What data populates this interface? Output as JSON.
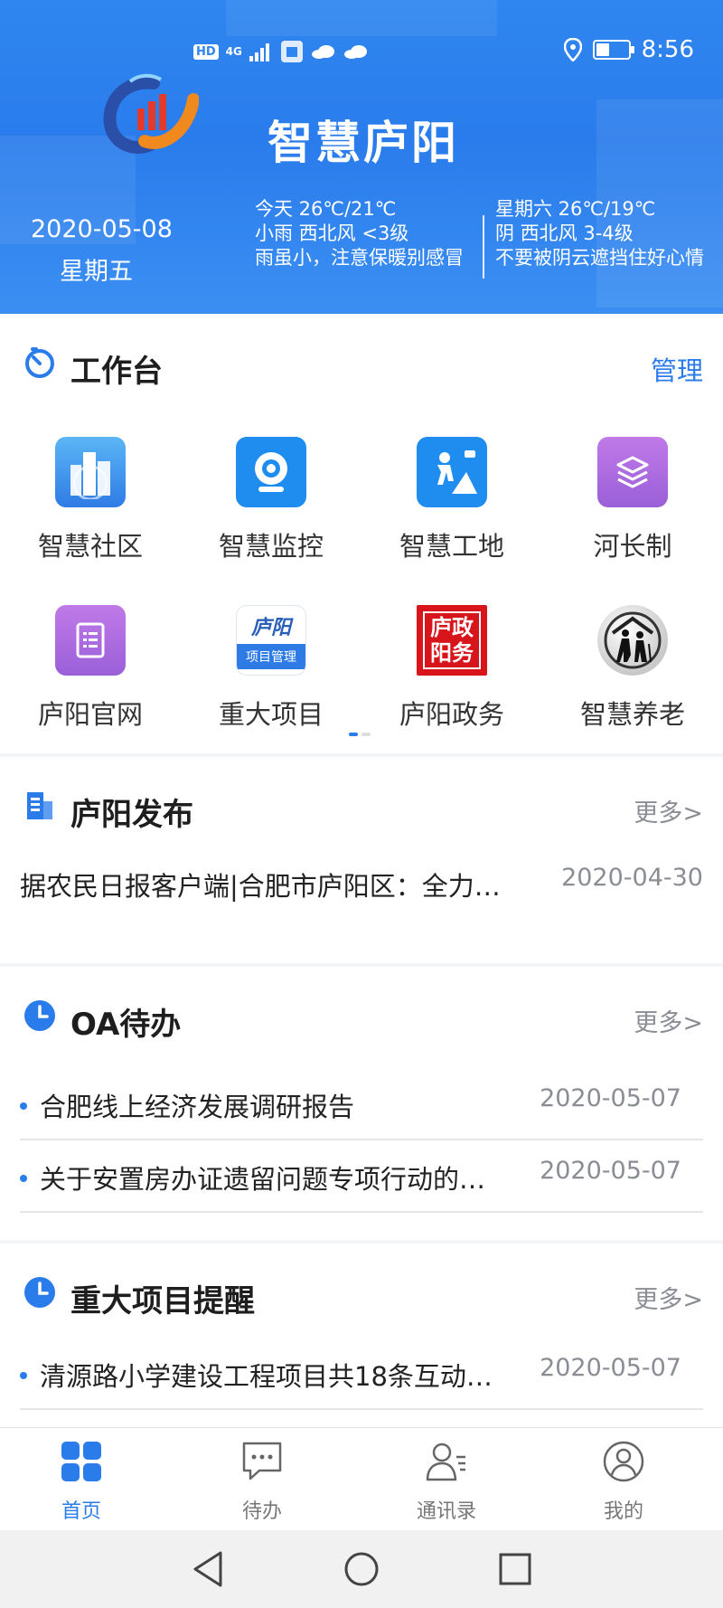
{
  "status_bar": {
    "hd": "HD",
    "network": "4G",
    "time": "8:56"
  },
  "header": {
    "app_title": "智慧庐阳",
    "date": "2020-05-08",
    "weekday": "星期五",
    "today": {
      "line1": "今天  26℃/21℃",
      "line2": "小雨  西北风  <3级",
      "line3": "雨虽小，注意保暖别感冒"
    },
    "tomorrow": {
      "line1": "星期六  26℃/19℃",
      "line2": "阴  西北风  3-4级",
      "line3": "不要被阴云遮挡住好心情"
    }
  },
  "workbench": {
    "title": "工作台",
    "manage_label": "管理",
    "apps": [
      {
        "label": "智慧社区",
        "icon": "city-buildings-icon"
      },
      {
        "label": "智慧监控",
        "icon": "camera-icon"
      },
      {
        "label": "智慧工地",
        "icon": "construction-worker-icon"
      },
      {
        "label": "河长制",
        "icon": "layers-icon"
      },
      {
        "label": "庐阳官网",
        "icon": "document-list-icon"
      },
      {
        "label": "重大项目",
        "icon": "project-management-icon",
        "icon_text_top": "庐阳",
        "icon_text_bottom": "项目管理"
      },
      {
        "label": "庐阳政务",
        "icon": "seal-icon",
        "icon_text": "庐政阳务"
      },
      {
        "label": "智慧养老",
        "icon": "elderly-icon"
      }
    ],
    "page_indicator": {
      "pages": 2,
      "current": 1
    }
  },
  "news": {
    "title": "庐阳发布",
    "more_label": "更多>",
    "items": [
      {
        "title": "据农民日报客户端|合肥市庐阳区：全力…",
        "date": "2020-04-30"
      }
    ]
  },
  "oa": {
    "title": "OA待办",
    "more_label": "更多>",
    "items": [
      {
        "title": "合肥线上经济发展调研报告",
        "date": "2020-05-07"
      },
      {
        "title": "关于安置房办证遗留问题专项行动的…",
        "date": "2020-05-07"
      }
    ]
  },
  "projects": {
    "title": "重大项目提醒",
    "more_label": "更多>",
    "items": [
      {
        "title": "清源路小学建设工程项目共18条互动…",
        "date": "2020-05-07"
      }
    ]
  },
  "tabbar": {
    "items": [
      {
        "label": "首页",
        "icon": "home-grid-icon",
        "active": true
      },
      {
        "label": "待办",
        "icon": "chat-bubble-icon",
        "active": false
      },
      {
        "label": "通讯录",
        "icon": "contacts-icon",
        "active": false
      },
      {
        "label": "我的",
        "icon": "profile-icon",
        "active": false
      }
    ]
  },
  "colors": {
    "accent": "#2b7ceb",
    "header_blue": "#2f86f0",
    "muted": "#8a8d94"
  }
}
